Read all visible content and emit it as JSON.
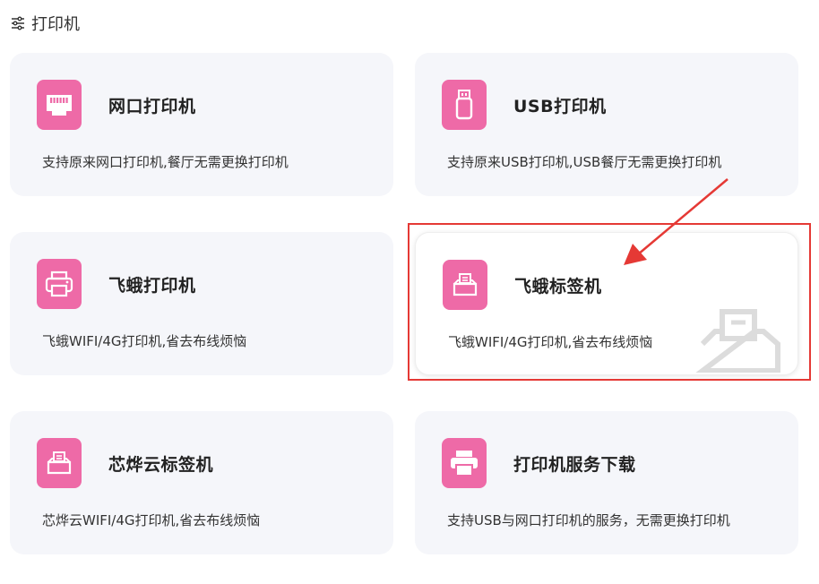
{
  "header": {
    "icon": "sliders-icon",
    "title": "打印机"
  },
  "cards": [
    {
      "icon": "ethernet-port-icon",
      "title": "网口打印机",
      "desc": "支持原来网口打印机,餐厅无需更换打印机"
    },
    {
      "icon": "usb-drive-icon",
      "title": "USB打印机",
      "desc": "支持原来USB打印机,USB餐厅无需更换打印机"
    },
    {
      "icon": "printer-icon",
      "title": "飞蛾打印机",
      "desc": "飞蛾WIFI/4G打印机,省去布线烦恼"
    },
    {
      "icon": "label-printer-icon",
      "title": "飞蛾标签机",
      "desc": "飞蛾WIFI/4G打印机,省去布线烦恼",
      "selected": true
    },
    {
      "icon": "label-printer-icon",
      "title": "芯烨云标签机",
      "desc": "芯烨云WIFI/4G打印机,省去布线烦恼"
    },
    {
      "icon": "printer-download-icon",
      "title": "打印机服务下载",
      "desc": "支持USB与网口打印机的服务，无需更换打印机"
    }
  ],
  "colors": {
    "icon_bg": "#ee6aa7",
    "card_bg": "#f5f6fa",
    "highlight": "#e53935",
    "arrow": "#e53935"
  }
}
